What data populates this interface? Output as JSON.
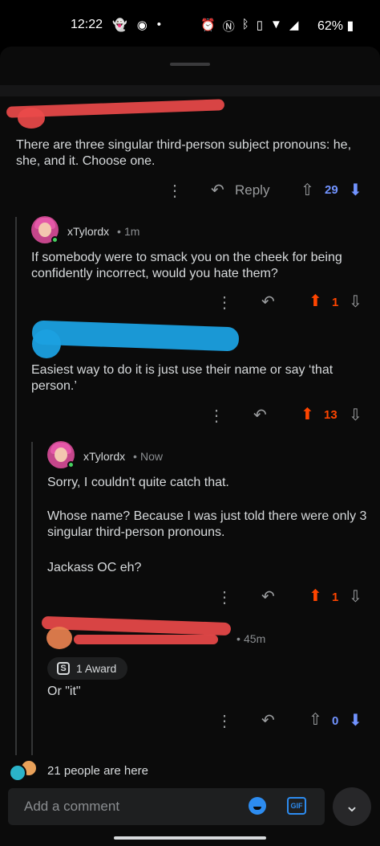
{
  "status_bar": {
    "time": "12:22",
    "battery": "62%",
    "icons_left": [
      "snapchat-icon",
      "discord-icon",
      "dot-icon"
    ],
    "icons_right": [
      "alarm-icon",
      "nfc-icon",
      "bluetooth-icon",
      "vibrate-icon",
      "wifi-icon",
      "signal-icon",
      "battery-icon"
    ]
  },
  "comments": [
    {
      "id": "c1",
      "text": "There are three singular third-person subject pronouns: he, she, and it. Choose one.",
      "reply_label": "Reply",
      "score": "29",
      "vote": "down"
    },
    {
      "id": "c2",
      "username": "xTylordx",
      "time": "1m",
      "text": "If somebody were to smack you on the cheek for being confidently incorrect, would you hate them?",
      "score": "1",
      "vote": "up"
    },
    {
      "id": "c3",
      "text": "Easiest way to do it is just use their name or say ‘that person.’",
      "score": "13",
      "vote": "up"
    },
    {
      "id": "c4",
      "username": "xTylordx",
      "time": "Now",
      "text_lines": [
        "Sorry, I couldn't quite catch that.",
        "Whose name? Because I was just told there were only 3 singular third-person pronouns.",
        "Jackass OC eh?"
      ],
      "score": "1",
      "vote": "up"
    },
    {
      "id": "c5",
      "time": "45m",
      "award": "1 Award",
      "text": "Or \"it\"",
      "score": "0",
      "vote": "down"
    }
  ],
  "footer": {
    "presence_text": "21 people are here",
    "input_placeholder": "Add a comment",
    "gif_label": "GIF"
  },
  "colors": {
    "upvote": "#ff4500",
    "downvote": "#7193ff",
    "neutral": "#818384"
  }
}
